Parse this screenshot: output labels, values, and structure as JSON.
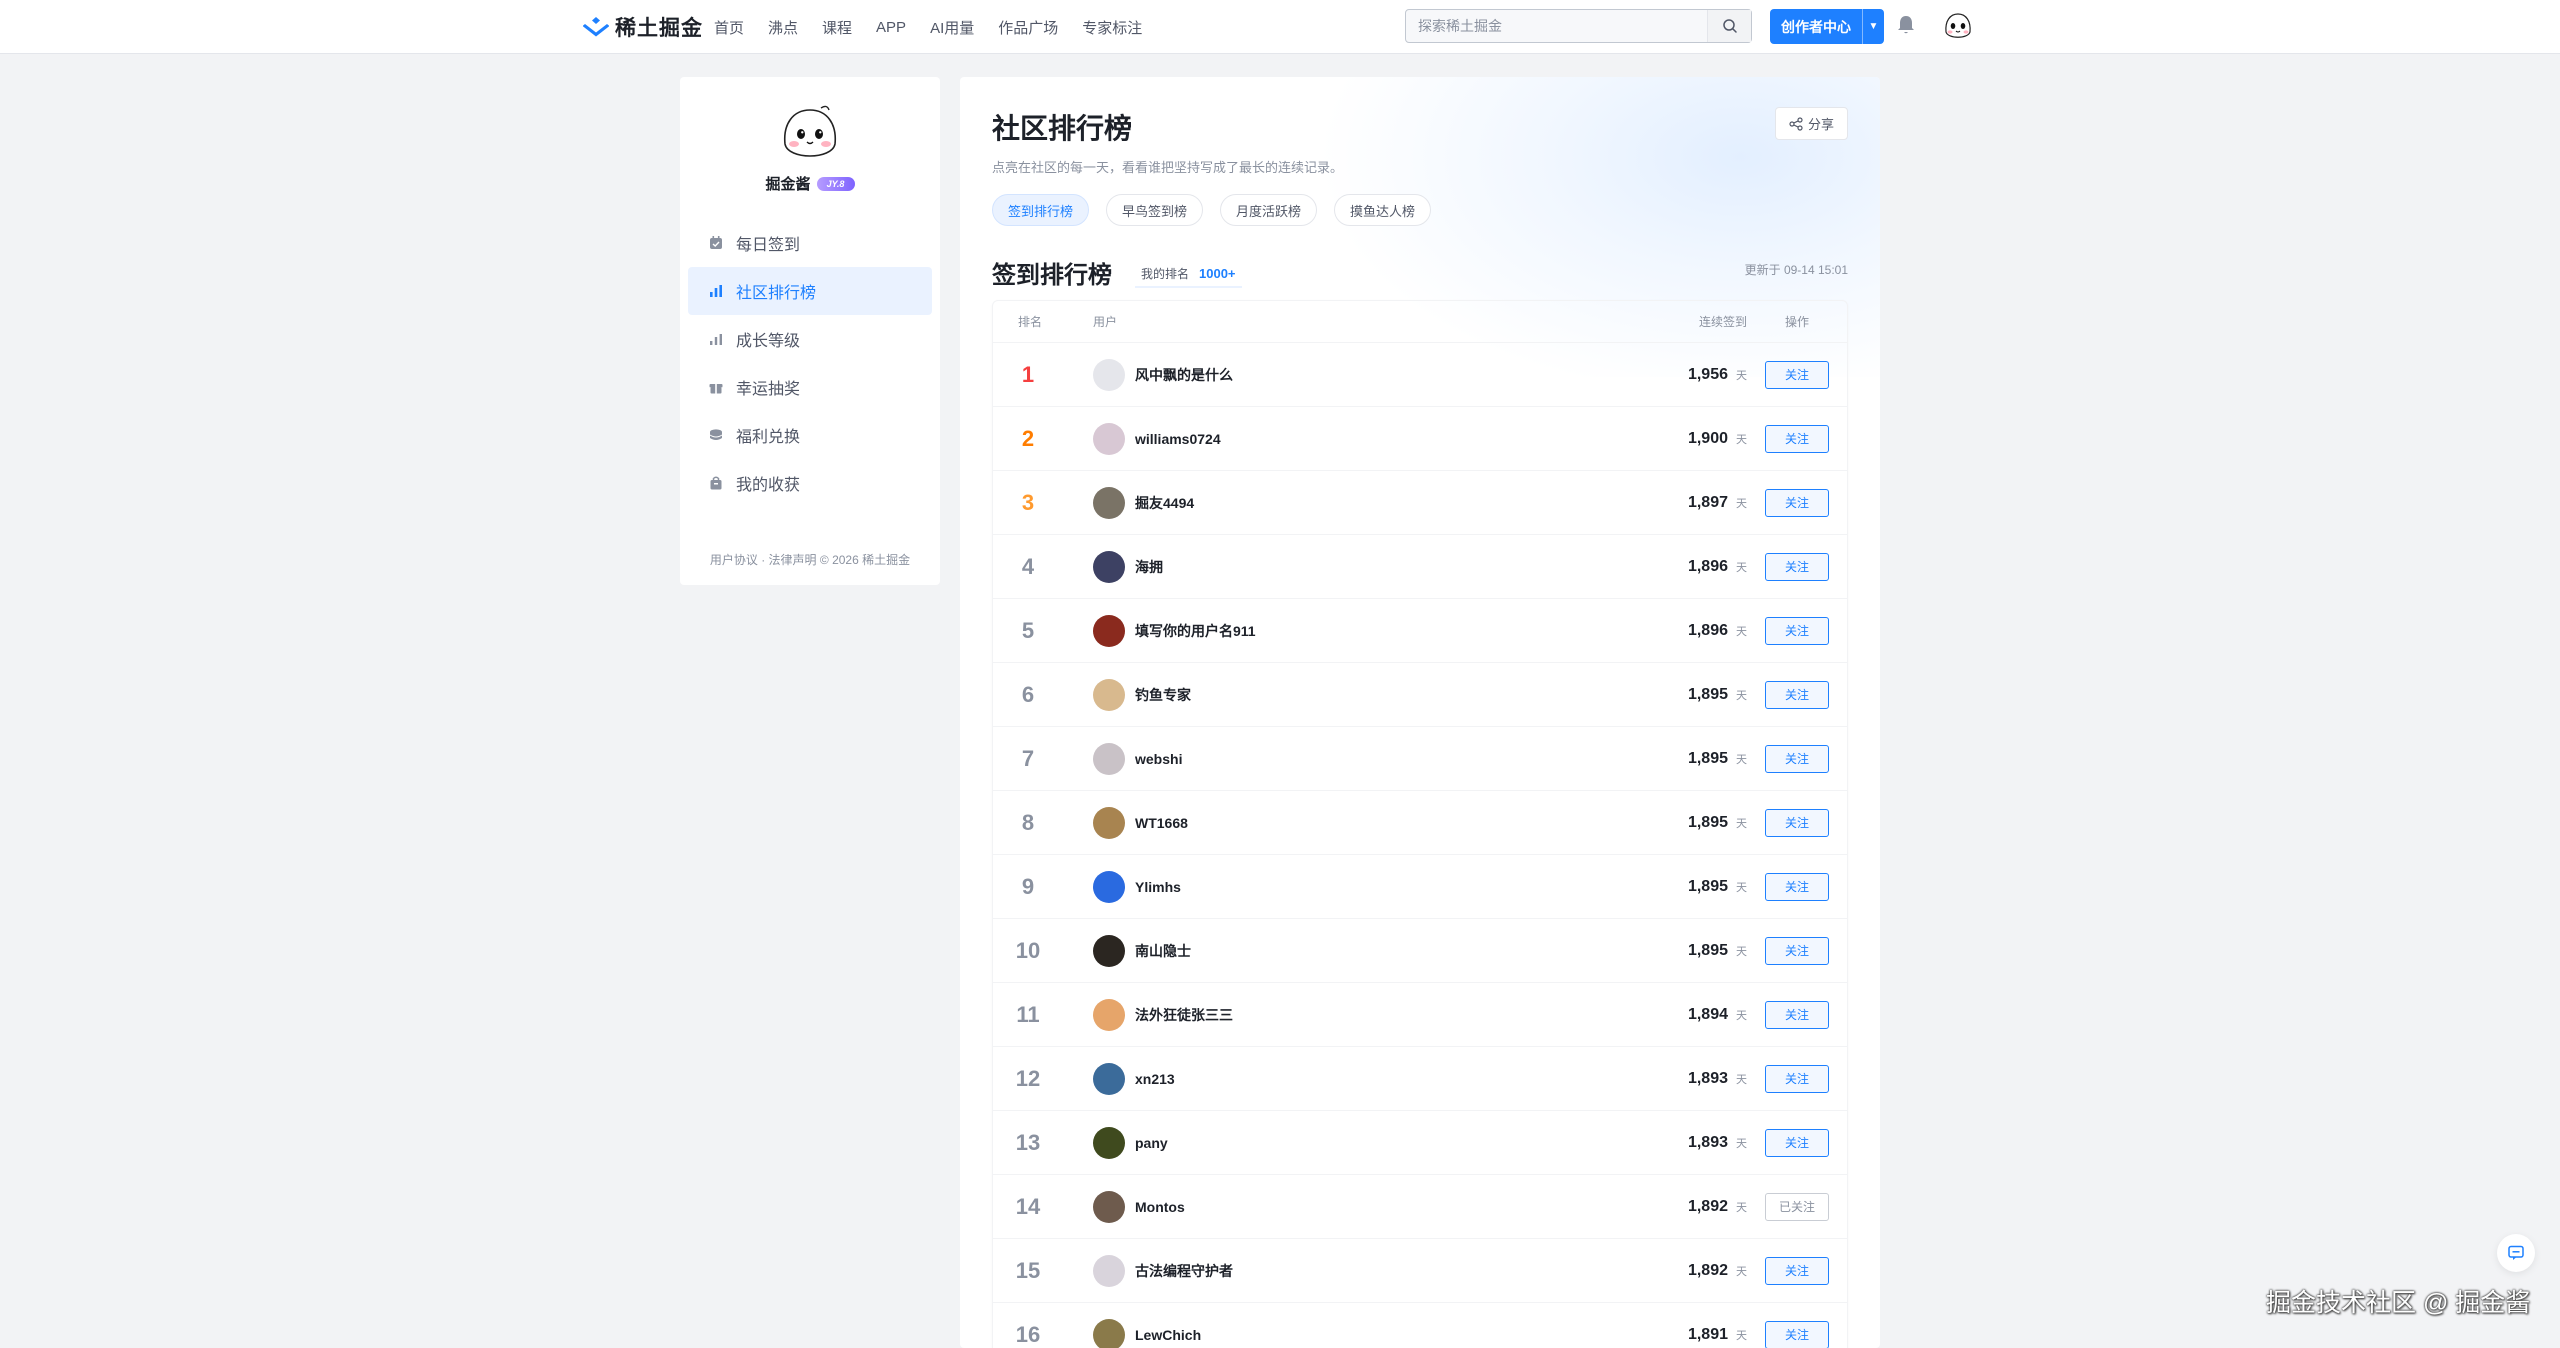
{
  "header": {
    "logo_text": "稀土掘金",
    "nav": [
      "首页",
      "沸点",
      "课程",
      "APP",
      "AI用量",
      "作品广场",
      "专家标注"
    ],
    "search_placeholder": "探索稀土掘金",
    "creator_label": "创作者中心"
  },
  "sidebar": {
    "profile_name": "掘金酱",
    "badge": "JY.8",
    "menu": [
      {
        "label": "每日签到",
        "icon": "calendar-check-icon"
      },
      {
        "label": "社区排行榜",
        "icon": "bar-chart-icon"
      },
      {
        "label": "成长等级",
        "icon": "level-chart-icon"
      },
      {
        "label": "幸运抽奖",
        "icon": "gift-icon"
      },
      {
        "label": "福利兑换",
        "icon": "coins-icon"
      },
      {
        "label": "我的收获",
        "icon": "bag-icon"
      }
    ],
    "active_index": 1,
    "footer": "用户协议 · 法律声明 © 2026 稀土掘金"
  },
  "main": {
    "title": "社区排行榜",
    "subtitle": "点亮在社区的每一天，看看谁把坚持写成了最长的连续记录。",
    "share_label": "分享",
    "tabs": [
      "签到排行榜",
      "早鸟签到榜",
      "月度活跃榜",
      "摸鱼达人榜"
    ],
    "active_tab": 0,
    "section_title": "签到排行榜",
    "my_rank_label": "我的排名",
    "my_rank_value": "1000+",
    "updated": "更新于 09-14 15:01"
  },
  "table": {
    "headers": {
      "rank": "排名",
      "user": "用户",
      "streak": "连续签到",
      "op": "操作"
    },
    "unit": "天",
    "rows": [
      {
        "rank": "1",
        "name": "风中飘的是什么",
        "days": "1,956",
        "action": "关注",
        "followed": false,
        "avatar": "#e5e6eb"
      },
      {
        "rank": "2",
        "name": "williams0724",
        "days": "1,900",
        "action": "关注",
        "followed": false,
        "avatar": "#d8c8d4"
      },
      {
        "rank": "3",
        "name": "掘友4494",
        "days": "1,897",
        "action": "关注",
        "followed": false,
        "avatar": "#7a7366"
      },
      {
        "rank": "4",
        "name": "海拥",
        "days": "1,896",
        "action": "关注",
        "followed": false,
        "avatar": "#3d4163"
      },
      {
        "rank": "5",
        "name": "填写你的用户名911",
        "days": "1,896",
        "action": "关注",
        "followed": false,
        "avatar": "#8a2a1e"
      },
      {
        "rank": "6",
        "name": "钓鱼专家",
        "days": "1,895",
        "action": "关注",
        "followed": false,
        "avatar": "#d8b98e"
      },
      {
        "rank": "7",
        "name": "webshi",
        "days": "1,895",
        "action": "关注",
        "followed": false,
        "avatar": "#c9c2c7"
      },
      {
        "rank": "8",
        "name": "WT1668",
        "days": "1,895",
        "action": "关注",
        "followed": false,
        "avatar": "#a88450"
      },
      {
        "rank": "9",
        "name": "Ylimhs",
        "days": "1,895",
        "action": "关注",
        "followed": false,
        "avatar": "#2a6ae0"
      },
      {
        "rank": "10",
        "name": "南山隐士",
        "days": "1,895",
        "action": "关注",
        "followed": false,
        "avatar": "#2b2621"
      },
      {
        "rank": "11",
        "name": "法外狂徒张三三",
        "days": "1,894",
        "action": "关注",
        "followed": false,
        "avatar": "#e6a56a"
      },
      {
        "rank": "12",
        "name": "xn213",
        "days": "1,893",
        "action": "关注",
        "followed": false,
        "avatar": "#3b6b9a"
      },
      {
        "rank": "13",
        "name": "pany",
        "days": "1,893",
        "action": "关注",
        "followed": false,
        "avatar": "#3f4a1e"
      },
      {
        "rank": "14",
        "name": "Montos",
        "days": "1,892",
        "action": "已关注",
        "followed": true,
        "avatar": "#6e5b4d"
      },
      {
        "rank": "15",
        "name": "古法编程守护者",
        "days": "1,892",
        "action": "关注",
        "followed": false,
        "avatar": "#d9d4dc"
      },
      {
        "rank": "16",
        "name": "LewChich",
        "days": "1,891",
        "action": "关注",
        "followed": false,
        "avatar": "#8a7a4a"
      }
    ]
  },
  "watermark": "掘金技术社区 @ 掘金酱",
  "colors": {
    "accent": "#1e80ff",
    "gold": "#f53f3f",
    "silver": "#ff7d00",
    "bronze": "#ff9a2e"
  }
}
